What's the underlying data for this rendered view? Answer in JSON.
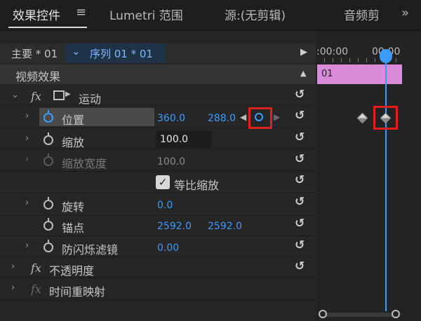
{
  "tabs": [
    {
      "label": "效果控件"
    },
    {
      "label": "Lumetri 范围"
    },
    {
      "label": "源:(无剪辑)"
    },
    {
      "label": "音频剪"
    }
  ],
  "menu_icon": "hamburger-icon",
  "overflow_icon": "double-chevron-right-icon",
  "header": {
    "master_label": "主要 * 01",
    "sequence_label": "序列 01 * 01",
    "timecode_left": ":00:00",
    "timecode_right": "00:00"
  },
  "section_title": "视频效果",
  "clip_label": "01",
  "motion": {
    "label": "运动",
    "properties": {
      "position": {
        "label": "位置",
        "x": "360.0",
        "y": "288.0"
      },
      "scale": {
        "label": "缩放",
        "value": "100.0"
      },
      "scale_width": {
        "label": "缩放宽度",
        "value": "100.0"
      },
      "uniform_scale": {
        "label": "等比缩放",
        "checked": true
      },
      "rotation": {
        "label": "旋转",
        "value": "0.0"
      },
      "anchor": {
        "label": "锚点",
        "x": "2592.0",
        "y": "2592.0"
      },
      "anti_flicker": {
        "label": "防闪烁滤镜",
        "value": "0.00"
      }
    }
  },
  "opacity": {
    "label": "不透明度"
  },
  "time_remap": {
    "label": "时间重映射"
  },
  "colors": {
    "accent": "#3d9bff",
    "clip": "#d98ad9",
    "highlight": "#e02020"
  }
}
